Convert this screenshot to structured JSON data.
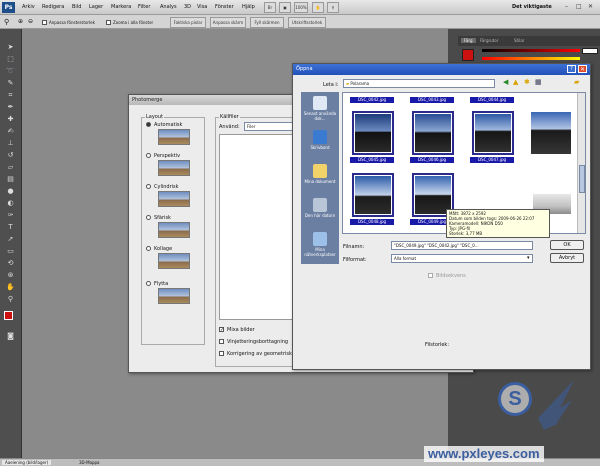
{
  "app": {
    "logo": "Ps"
  },
  "menu": [
    "Arkiv",
    "Redigera",
    "Bild",
    "Lager",
    "Markera",
    "Filter",
    "Analys",
    "3D",
    "Visa",
    "Fönster",
    "Hjälp"
  ],
  "topright": {
    "workspace": "Det viktigaste",
    "zoom": "100%"
  },
  "options": {
    "resize_windows": "Anpassa fönsterstorlek",
    "zoom_all": "Zooma i alla fönster",
    "actual_pixels": "Faktiska pixlar",
    "fit_screen": "Anpassa skärm",
    "fill_screen": "Fyll skärmen",
    "print_size": "Utskriftsstorlek"
  },
  "panels": {
    "tabs": [
      "Färg",
      "Färgrutor",
      "Stilar"
    ]
  },
  "photomerge": {
    "title": "Photomerge",
    "layout_label": "Layout",
    "layouts": [
      "Automatisk",
      "Perspektiv",
      "Cylindrisk",
      "Sfärisk",
      "Kollage",
      "Flytta"
    ],
    "source_label": "Källfiler",
    "use_label": "Använd:",
    "use_value": "Filer",
    "blend_label": "Mixa bilder",
    "vignette_label": "Vinjetteringsborttagning",
    "geo_label": "Korrigering av geometrisk"
  },
  "open_dialog": {
    "title": "Öppna",
    "look_in_label": "Leta i:",
    "look_in_value": "Polarama",
    "places": [
      "Senast använda dok...",
      "Skrivbord",
      "Mina dokument",
      "Den här datorn",
      "Mina nätverksplatser"
    ],
    "thumbs": [
      "DSC_0042.jpg",
      "DSC_0043.jpg",
      "DSC_0044.jpg",
      "DSC_0045.jpg",
      "DSC_0046.jpg",
      "DSC_0047.jpg",
      "DSC_0048.jpg",
      "DSC_0049.jpg",
      ""
    ],
    "filename_label": "Filnamn:",
    "filename_value": "\"DSC_0049.jpg\" \"DSC_0042.jpg\" \"DSC_0...",
    "filetype_label": "Filformat:",
    "filetype_value": "Alla format",
    "ok_label": "OK",
    "cancel_label": "Avbryt",
    "image_sequence": "Bildsekvens",
    "file_size_label": "Filstorlek:",
    "tooltip": [
      "Mått: 3872 x 2592",
      "Datum som bilden togs: 2009-06-26 22:07",
      "Kameramodell: NIKON D50",
      "Typ: JPG-fil",
      "Storlek: 3,77 MB"
    ]
  },
  "status": {
    "tab1": "Aaeiening (bild/lager)",
    "tab2": "3D-Mappa"
  },
  "watermark": {
    "site": "www.pxleyes.com",
    "brand": "S"
  },
  "colors": {
    "xp_blue": "#2250b8",
    "thumb_border": "#2a2a8c",
    "fg_swatch": "#cc1111"
  }
}
